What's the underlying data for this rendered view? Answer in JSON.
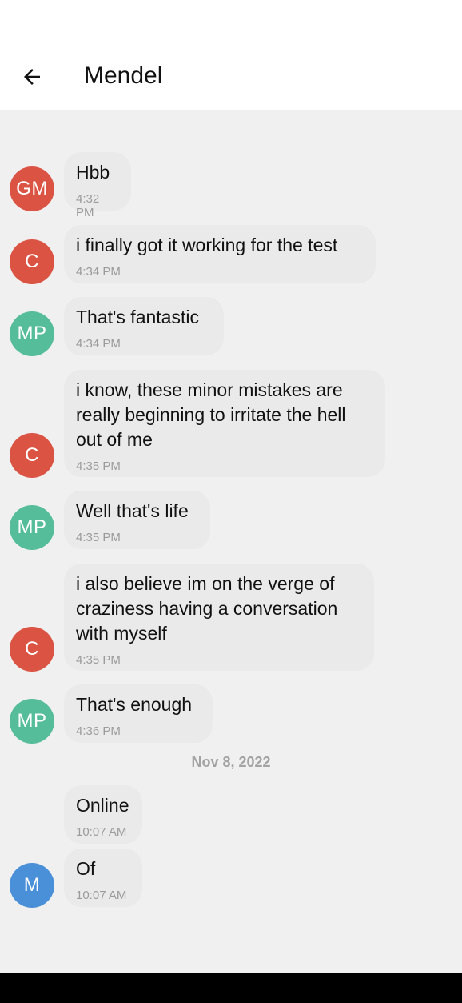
{
  "header": {
    "title": "Mendel"
  },
  "colors": {
    "red": "#db5443",
    "green": "#55bd9a",
    "blue": "#4a90d9"
  },
  "messages": [
    {
      "avatar": "GM",
      "color": "red",
      "text": "Hbb",
      "time": "4:32 PM"
    },
    {
      "avatar": "C",
      "color": "red",
      "text": "i finally got it working for the test",
      "time": "4:34 PM"
    },
    {
      "avatar": "MP",
      "color": "green",
      "text": "That's fantastic",
      "time": "4:34 PM"
    },
    {
      "avatar": "C",
      "color": "red",
      "text": "i know, these minor mistakes are really beginning to irritate the hell out of me",
      "time": "4:35 PM"
    },
    {
      "avatar": "MP",
      "color": "green",
      "text": "Well that's life",
      "time": "4:35 PM"
    },
    {
      "avatar": "C",
      "color": "red",
      "text": "i also believe im on the verge of craziness having a conversation with myself",
      "time": "4:35 PM"
    },
    {
      "avatar": "MP",
      "color": "green",
      "text": "That's enough",
      "time": "4:36 PM"
    },
    {
      "avatar": "",
      "color": "",
      "text": "Online",
      "time": "10:07 AM"
    },
    {
      "avatar": "M",
      "color": "blue",
      "text": "Of",
      "time": "10:07 AM"
    }
  ],
  "date_separator": "Nov 8, 2022"
}
